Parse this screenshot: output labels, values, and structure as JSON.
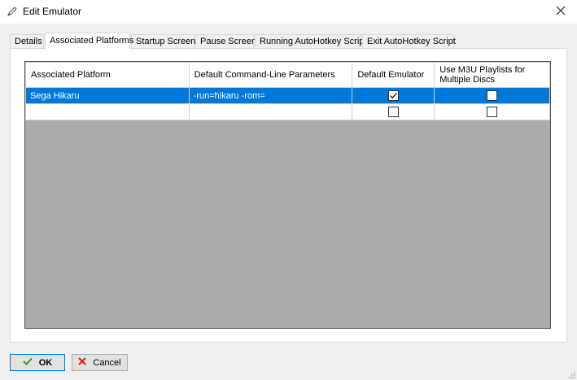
{
  "window": {
    "title": "Edit Emulator",
    "title_icon": "pencil-icon",
    "close_icon": "close-icon"
  },
  "tabs": [
    {
      "label": "Details",
      "active": false
    },
    {
      "label": "Associated Platforms",
      "active": true
    },
    {
      "label": "Startup Screen",
      "active": false
    },
    {
      "label": "Pause Screen",
      "active": false
    },
    {
      "label": "Running AutoHotkey Script",
      "active": false
    },
    {
      "label": "Exit AutoHotkey Script",
      "active": false
    }
  ],
  "grid": {
    "columns": [
      "Associated Platform",
      "Default Command-Line Parameters",
      "Default Emulator",
      "Use M3U Playlists for Multiple Discs"
    ],
    "rows": [
      {
        "platform": "Sega Hikaru",
        "params": "-run=hikaru -rom=",
        "default_emulator": true,
        "use_m3u": false,
        "selected": true
      },
      {
        "platform": "",
        "params": "",
        "default_emulator": false,
        "use_m3u": false,
        "selected": false
      }
    ]
  },
  "buttons": {
    "ok_label": "OK",
    "ok_icon": "checkmark-icon",
    "cancel_label": "Cancel",
    "cancel_icon": "x-icon"
  },
  "colors": {
    "selection": "#0078d7",
    "grid_background": "#ababab",
    "ok_icon": "#2e9e2e",
    "cancel_icon": "#d02020"
  }
}
